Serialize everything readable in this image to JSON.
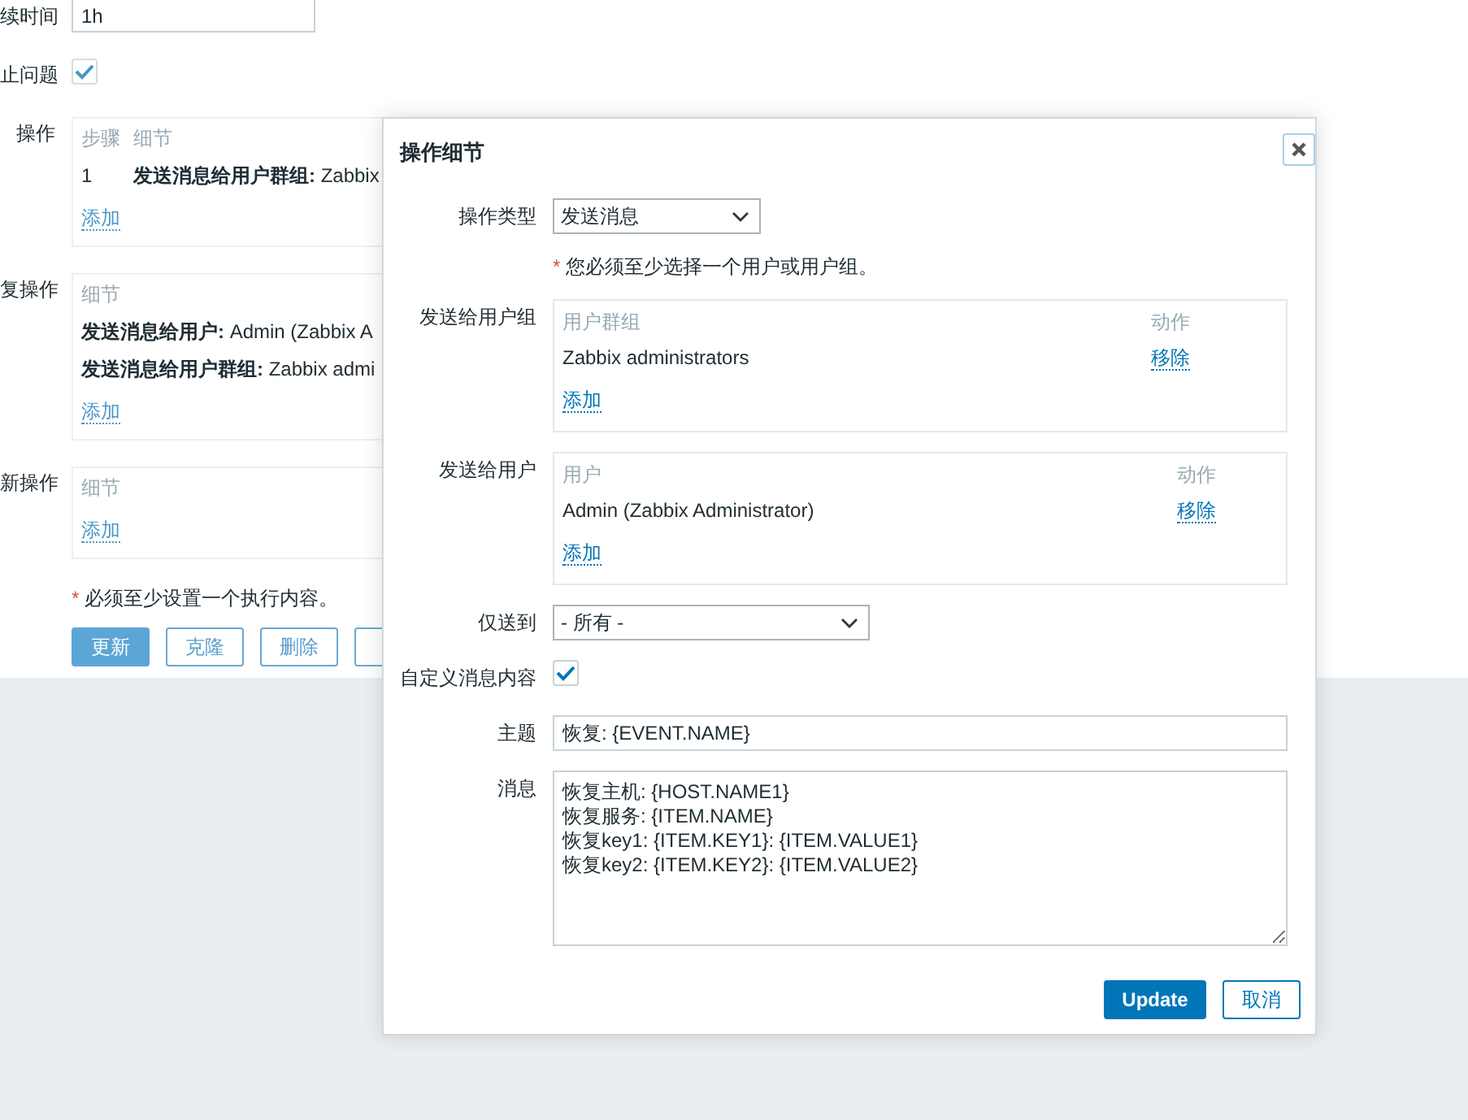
{
  "background_form": {
    "rows": [
      {
        "kind": "input",
        "label": "续时间",
        "value": "1h"
      },
      {
        "kind": "checkbox",
        "label": "止问题",
        "checked": true
      }
    ],
    "operations": {
      "label": "操作",
      "columns": [
        "步骤",
        "细节"
      ],
      "rows": [
        {
          "step": "1",
          "detail": "**发送消息给用户群组:** Zabbix"
        }
      ],
      "add_link": "添加"
    },
    "recovery_operations": {
      "label": "复操作",
      "columns": [
        "细节"
      ],
      "rows": [
        {
          "detail": "**发送消息给用户:** Admin (Zabbix A"
        },
        {
          "detail": "**发送消息给用户群组:** Zabbix admi"
        }
      ],
      "add_link": "添加"
    },
    "update_operations": {
      "label": "新操作",
      "columns": [
        "细节"
      ],
      "add_link": "添加"
    },
    "required_mark": "*",
    "required_note": "必须至少设置一个执行内容。",
    "buttons": [
      {
        "label": "更新",
        "kind": "primary"
      },
      {
        "label": "克隆",
        "kind": "secondary"
      },
      {
        "label": "删除",
        "kind": "secondary"
      },
      {
        "kind": "hidden"
      }
    ]
  },
  "dialog": {
    "title": "操作细节",
    "operation_type": {
      "label": "操作类型",
      "value": "发送消息"
    },
    "note_mark": "*",
    "note": "您必须至少选择一个用户或用户组。",
    "send_to_groups": {
      "label": "发送给用户组",
      "columns": [
        "用户群组",
        "动作"
      ],
      "rows": [
        {
          "name": "Zabbix administrators",
          "action": "移除"
        }
      ],
      "add_link": "添加"
    },
    "send_to_users": {
      "label": "发送给用户",
      "columns": [
        "用户",
        "动作"
      ],
      "rows": [
        {
          "name": "Admin (Zabbix Administrator)",
          "action": "移除"
        }
      ],
      "add_link": "添加"
    },
    "send_only_to": {
      "label": "仅送到",
      "value": "- 所有 -"
    },
    "custom_message": {
      "label": "自定义消息内容",
      "checked": true
    },
    "subject": {
      "label": "主题",
      "value": "恢复: {EVENT.NAME}"
    },
    "message": {
      "label": "消息",
      "value": "恢复主机: {HOST.NAME1}\n恢复服务: {ITEM.NAME}\n恢复key1: {ITEM.KEY1}: {ITEM.VALUE1}\n恢复key2: {ITEM.KEY2}: {ITEM.VALUE2}"
    },
    "buttons": [
      {
        "label": "Update",
        "kind": "primary"
      },
      {
        "label": "取消",
        "kind": "secondary"
      }
    ]
  }
}
